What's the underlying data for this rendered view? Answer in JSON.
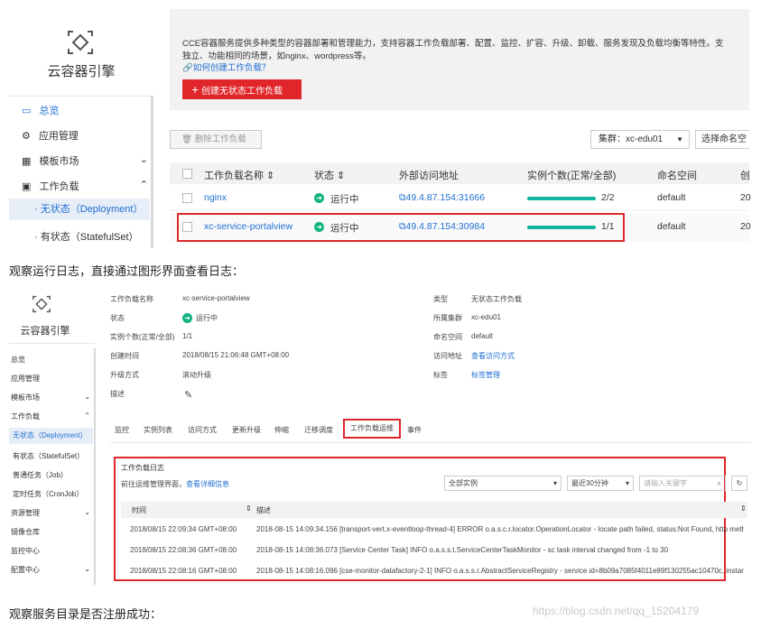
{
  "top": {
    "sidebar": {
      "title": "云容器引擎",
      "items": [
        {
          "label": "总览"
        },
        {
          "label": "应用管理"
        },
        {
          "label": "模板市场"
        },
        {
          "label": "工作负载"
        },
        {
          "label": "无状态（Deployment）"
        },
        {
          "label": "有状态（StatefulSet）"
        }
      ]
    },
    "intro": {
      "line1": "CCE容器服务提供多种类型的容器部署和管理能力，支持容器工作负载部署、配置、监控、扩容、升级、卸载、服务发现及负载均衡等特性。支",
      "line2": "独立、功能相同的场景，如nginx、wordpress等。",
      "link": "如何创建工作负载？",
      "create_button": "创建无状态工作负载"
    },
    "toolbar": {
      "delete_button": "删除工作负载",
      "cluster_select": "集群：xc-edu01",
      "namespace_select": "选择命名空"
    },
    "table": {
      "headers": [
        "工作负载名称 ⇕",
        "状态 ⇕",
        "外部访问地址",
        "实例个数(正常/全部)",
        "命名空间",
        "创"
      ],
      "rows": [
        {
          "name": "nginx",
          "status": "运行中",
          "address": "49.4.87.154:31666",
          "instances": "2/2",
          "progress": 1.0,
          "namespace": "default",
          "created": "20"
        },
        {
          "name": "xc-service-portalview",
          "status": "运行中",
          "address": "49.4.87.154:30984",
          "instances": "1/1",
          "progress": 1.0,
          "namespace": "default",
          "created": "20"
        }
      ]
    }
  },
  "text_between": "观察运行日志，直接通过图形界面查看日志：",
  "bottom": {
    "sidebar": {
      "title": "云容器引擎",
      "items": [
        {
          "label": "总览"
        },
        {
          "label": "应用管理"
        },
        {
          "label": "模板市场"
        },
        {
          "label": "工作负载"
        },
        {
          "label": "无状态（Deployment）"
        },
        {
          "label": "有状态（StatefulSet）"
        },
        {
          "label": "普通任务（Job）"
        },
        {
          "label": "定时任务（CronJob）"
        },
        {
          "label": "资源管理"
        },
        {
          "label": "镜像仓库"
        },
        {
          "label": "监控中心"
        },
        {
          "label": "配置中心"
        }
      ]
    },
    "details": {
      "left": [
        {
          "k": "工作负载名称",
          "v": "xc-service-portalview"
        },
        {
          "k": "状态",
          "v": "运行中"
        },
        {
          "k": "实例个数(正常/全部)",
          "v": "1/1"
        },
        {
          "k": "创建时间",
          "v": "2018/08/15 21:06:48 GMT+08:00"
        },
        {
          "k": "升级方式",
          "v": "滚动升级"
        },
        {
          "k": "描述",
          "v": "✎"
        }
      ],
      "right": [
        {
          "k": "类型",
          "v": "无状态工作负载"
        },
        {
          "k": "所属集群",
          "v": "xc-edu01"
        },
        {
          "k": "命名空间",
          "v": "default"
        },
        {
          "k": "访问地址",
          "v": "查看访问方式"
        },
        {
          "k": "标签",
          "v": "标签管理"
        }
      ]
    },
    "tabs": [
      "监控",
      "实例列表",
      "访问方式",
      "更新升级",
      "伸缩",
      "迁移调度",
      "工作负载运维",
      "事件"
    ],
    "log": {
      "title": "工作负载日志",
      "subtitle": "前往运维管理界面，",
      "sublink": "查看详细信息",
      "instance_select": "全部实例",
      "time_select": "最近30分钟",
      "search_placeholder": "请输入关键字",
      "headers": [
        "时间",
        "描述"
      ],
      "rows": [
        {
          "time": "2018/08/15 22:09:34 GMT+08:00",
          "desc": "2018-08-15 14:09:34.156 [transport-vert.x-eventloop-thread-4] ERROR o.a.s.c.r.locator.OperationLocator - locate path failed, status:Not Found, http method..."
        },
        {
          "time": "2018/08/15 22:08:36 GMT+08:00",
          "desc": "2018-08-15 14:08:36.073 [Service Center Task] INFO o.a.s.s.t.ServiceCenterTaskMonitor - sc task interval changed from -1 to 30"
        },
        {
          "time": "2018/08/15 22:08:16 GMT+08:00",
          "desc": "2018-08-15 14:08:16.096 [cse-monitor-datafactory-2-1] INFO o.a.s.s.r.AbstractServiceRegistry - service id=8b09a7085f4011e89f130255ac10470c, instance..."
        }
      ]
    }
  },
  "text_bottom": "观察服务目录是否注册成功：",
  "watermark": "https://blog.csdn.net/qq_15204179",
  "colors": {
    "accent": "#1f6fd3",
    "primary_button": "#e0262b",
    "highlight_border": "#e0262b",
    "progress": "#12b3a3"
  }
}
